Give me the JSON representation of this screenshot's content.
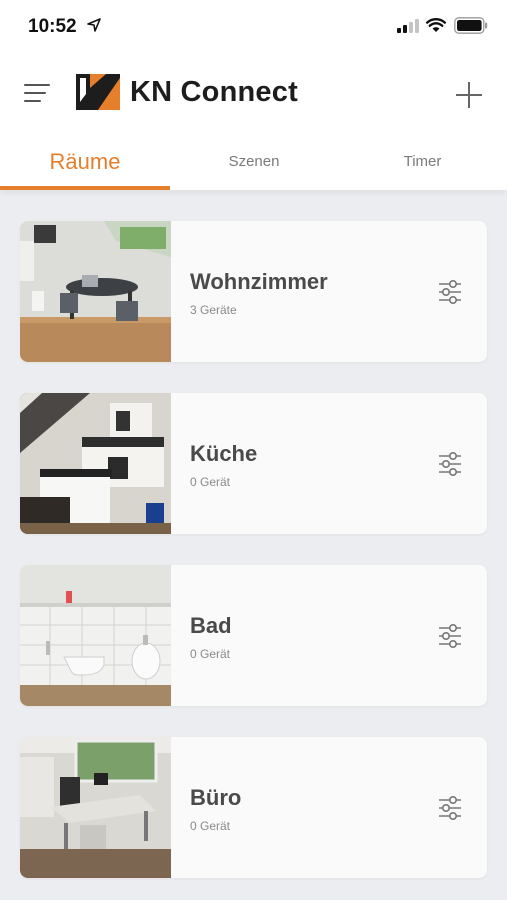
{
  "status_bar": {
    "time": "10:52"
  },
  "header": {
    "title": "KN Connect",
    "brand_color": "#e57f2c"
  },
  "tabs": [
    {
      "label": "Räume",
      "active": true
    },
    {
      "label": "Szenen",
      "active": false
    },
    {
      "label": "Timer",
      "active": false
    }
  ],
  "rooms": [
    {
      "name": "Wohnzimmer",
      "devices": "3 Geräte"
    },
    {
      "name": "Küche",
      "devices": "0 Gerät"
    },
    {
      "name": "Bad",
      "devices": "0 Gerät"
    },
    {
      "name": "Büro",
      "devices": "0 Gerät"
    }
  ],
  "icons": {
    "menu": "hamburger-menu-icon",
    "add": "plus-icon",
    "settings": "sliders-icon"
  }
}
